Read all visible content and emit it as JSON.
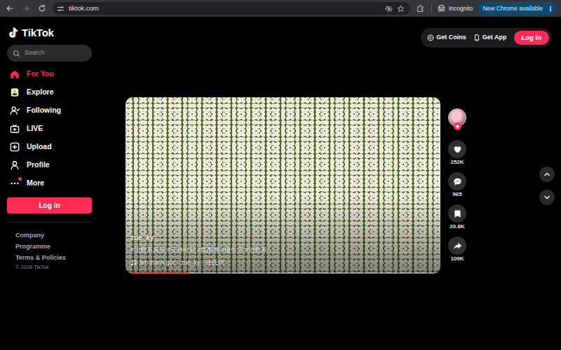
{
  "browser": {
    "url": "tiktok.com",
    "incognito": "Incognito",
    "update": "New Chrome available",
    "menu": "⋮"
  },
  "logo": "TikTok",
  "search": {
    "placeholder": "Search"
  },
  "sidebar": {
    "items": [
      {
        "label": "For You",
        "selected": true,
        "notification": false
      },
      {
        "label": "Explore",
        "selected": false,
        "notification": false
      },
      {
        "label": "Following",
        "selected": false,
        "notification": false
      },
      {
        "label": "LIVE",
        "selected": false,
        "notification": false
      },
      {
        "label": "Upload",
        "selected": false,
        "notification": false
      },
      {
        "label": "Profile",
        "selected": false,
        "notification": false
      },
      {
        "label": "More",
        "selected": false,
        "notification": true
      }
    ],
    "login": "Log in",
    "footer": [
      "Company",
      "Programme",
      "Terms & Policies",
      "© 2026 TikTok"
    ]
  },
  "header": {
    "coins": "Get Coins",
    "app": "Get App",
    "login": "Log in"
  },
  "video": {
    "author": "zue_ky",
    "caption": "#治愈系风景 #安静时刻 #氛围感 #慢生活 #治愈系",
    "music": "âm thanh gốc - zue_ky - 张氏琪",
    "progress": {
      "level": 0.2
    }
  },
  "actions": [
    {
      "kind": "like",
      "count": "252K"
    },
    {
      "kind": "comment",
      "count": "965"
    },
    {
      "kind": "save",
      "count": "20.8K"
    },
    {
      "kind": "share",
      "count": "109K"
    }
  ]
}
